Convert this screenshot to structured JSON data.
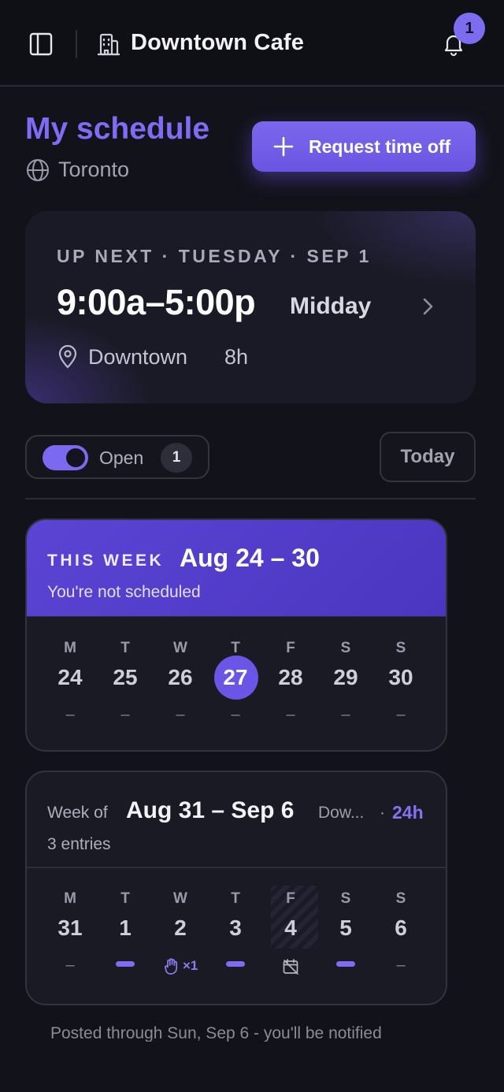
{
  "topbar": {
    "title": "Downtown Cafe",
    "notification_count": "1",
    "icons": [
      "sidebar-toggle-icon",
      "building-icon",
      "bell-icon"
    ]
  },
  "header": {
    "title": "My schedule",
    "location": "Toronto",
    "request_button": "Request time off"
  },
  "up_next": {
    "eyebrow": "UP NEXT · TUESDAY · SEP 1",
    "time": "9:00a–5:00p",
    "shift": "Midday",
    "place": "Downtown",
    "hours": "8h"
  },
  "filters": {
    "open_label": "Open",
    "open_count": "1",
    "open_enabled": true,
    "today_button": "Today"
  },
  "this_week": {
    "eyebrow": "THIS WEEK",
    "range": "Aug 24 – 30",
    "subtitle": "You're not scheduled",
    "days": [
      {
        "dow": "M",
        "num": "24",
        "mark": "–"
      },
      {
        "dow": "T",
        "num": "25",
        "mark": "–"
      },
      {
        "dow": "W",
        "num": "26",
        "mark": "–"
      },
      {
        "dow": "T",
        "num": "27",
        "mark": "–",
        "today": true
      },
      {
        "dow": "F",
        "num": "28",
        "mark": "–"
      },
      {
        "dow": "S",
        "num": "29",
        "mark": "–"
      },
      {
        "dow": "S",
        "num": "30",
        "mark": "–"
      }
    ]
  },
  "next_week": {
    "prefix": "Week of",
    "range": "Aug 31 – Sep 6",
    "location": "Dow...",
    "dot": "·",
    "hours": "24h",
    "entries": "3 entries",
    "days": [
      {
        "dow": "M",
        "num": "31",
        "mark": "–"
      },
      {
        "dow": "T",
        "num": "1",
        "indicator": "shift-bar"
      },
      {
        "dow": "W",
        "num": "2",
        "indicator": "open-shift",
        "label": "×1"
      },
      {
        "dow": "T",
        "num": "3",
        "indicator": "shift-bar"
      },
      {
        "dow": "F",
        "num": "4",
        "indicator": "unavailable-icon"
      },
      {
        "dow": "S",
        "num": "5",
        "indicator": "shift-bar"
      },
      {
        "dow": "S",
        "num": "6",
        "mark": "–"
      }
    ]
  },
  "footer": {
    "note": "Posted through Sun, Sep 6 - you'll be notified"
  },
  "colors": {
    "accent": "#7f6cf4",
    "background": "#12121a",
    "card": "#1a1a25",
    "this_week_header": "#5b44d4"
  }
}
